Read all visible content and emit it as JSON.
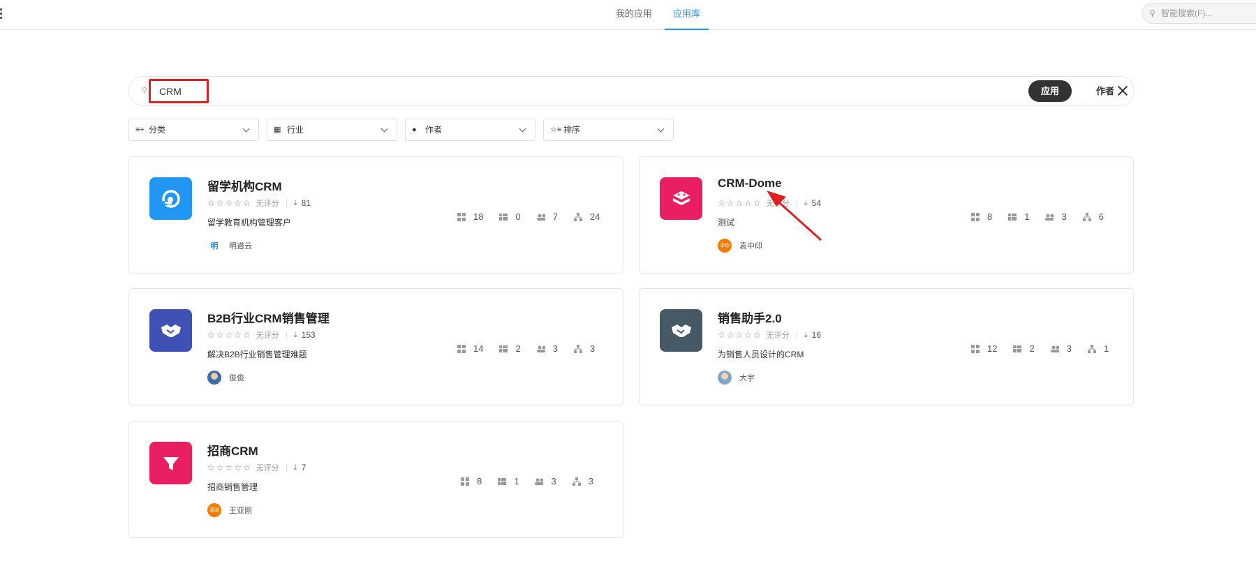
{
  "topbar": {
    "tabs": [
      {
        "label": "我的应用",
        "active": false
      },
      {
        "label": "应用库",
        "active": true
      }
    ],
    "smart_search_placeholder": "智能搜索(F)..."
  },
  "search": {
    "value": "CRM",
    "segments": {
      "app": "应用",
      "author": "作者"
    }
  },
  "filters": [
    {
      "label": "分类",
      "icon": "category-icon"
    },
    {
      "label": "行业",
      "icon": "industry-icon"
    },
    {
      "label": "作者",
      "icon": "author-icon"
    },
    {
      "label": "排序",
      "icon": "sort-icon"
    }
  ],
  "apps": [
    {
      "title": "留学机构CRM",
      "rating": "无评分",
      "downloads": "81",
      "description": "留学教育机构管理客户",
      "author": "明道云",
      "avatar_text": "明",
      "icon_color": "#2196f3",
      "stats": {
        "worksheets": "18",
        "views": "0",
        "roles": "7",
        "workflows": "24"
      }
    },
    {
      "title": "CRM-Dome",
      "rating": "无评分",
      "downloads": "54",
      "description": "测试",
      "author": "袁中印",
      "avatar_text": "中印",
      "icon_color": "#e91e63",
      "stats": {
        "worksheets": "8",
        "views": "1",
        "roles": "3",
        "workflows": "6"
      }
    },
    {
      "title": "B2B行业CRM销售管理",
      "rating": "无评分",
      "downloads": "153",
      "description": "解决B2B行业销售管理难题",
      "author": "俊俊",
      "avatar_text": "",
      "icon_color": "#3f51b5",
      "stats": {
        "worksheets": "14",
        "views": "2",
        "roles": "3",
        "workflows": "3"
      }
    },
    {
      "title": "销售助手2.0",
      "rating": "无评分",
      "downloads": "16",
      "description": "为销售人员设计的CRM",
      "author": "大宇",
      "avatar_text": "",
      "icon_color": "#455a64",
      "stats": {
        "worksheets": "12",
        "views": "2",
        "roles": "3",
        "workflows": "1"
      }
    },
    {
      "title": "招商CRM",
      "rating": "无评分",
      "downloads": "7",
      "description": "招商销售管理",
      "author": "王亚刚",
      "avatar_text": "亚刚",
      "icon_color": "#e91e63",
      "stats": {
        "worksheets": "8",
        "views": "1",
        "roles": "3",
        "workflows": "3"
      }
    }
  ],
  "colors": {
    "accent": "#2196f3",
    "highlight_box": "#e02020",
    "annotation_arrow": "#e02020"
  }
}
